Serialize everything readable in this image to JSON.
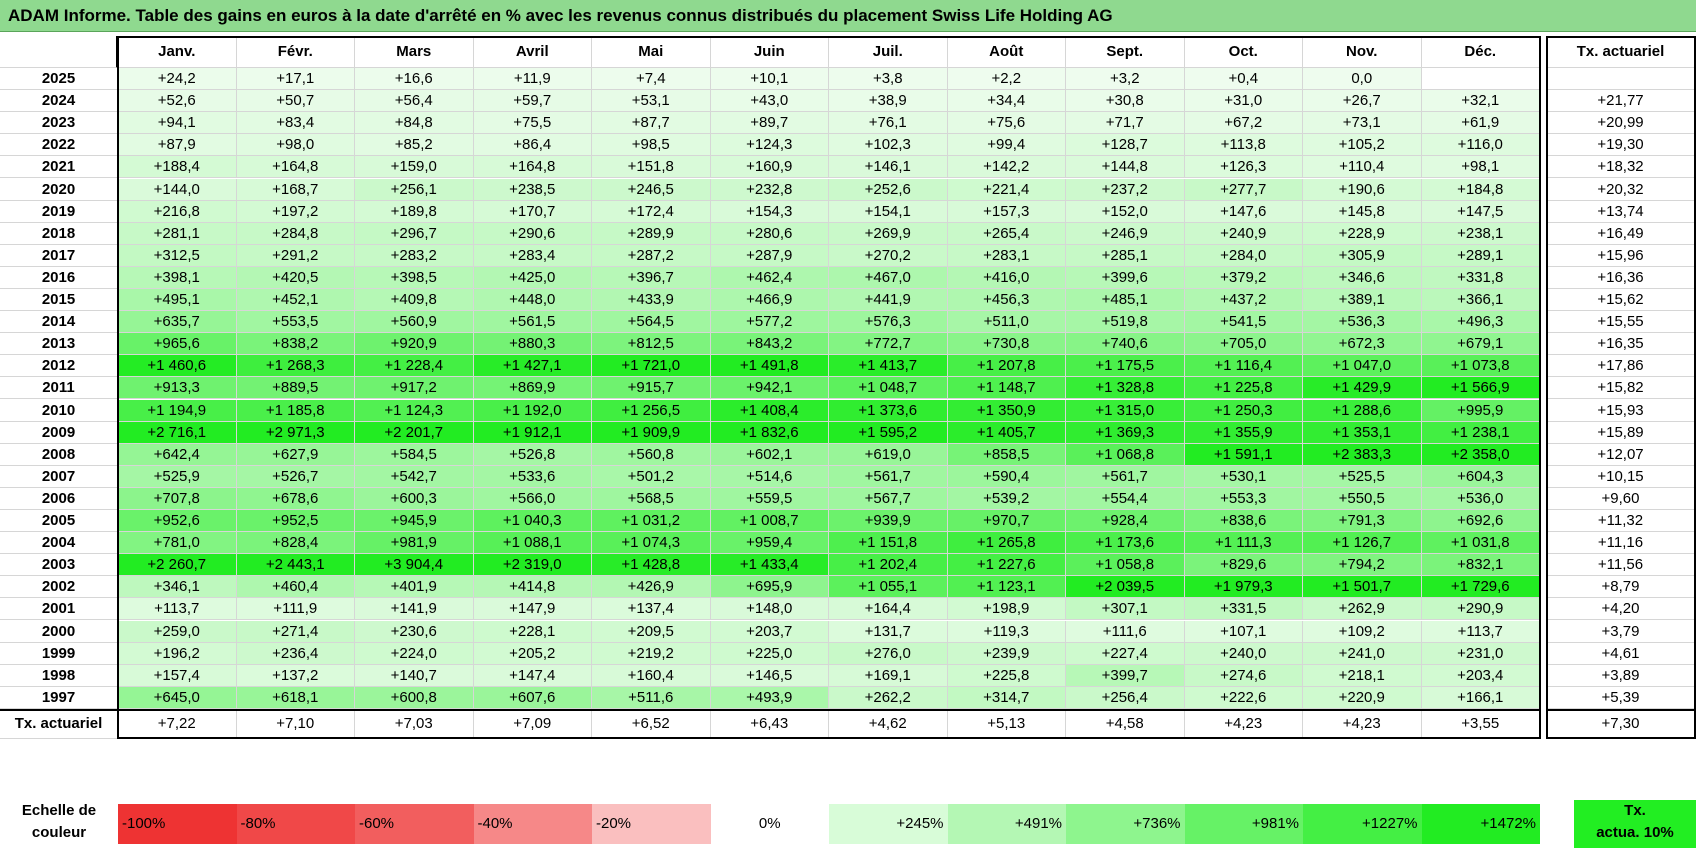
{
  "title": "ADAM Informe. Table des gains en euros à la date d'arrêté en % avec les revenus connus distribués du placement Swiss Life Holding AG",
  "months": [
    "Janv.",
    "Févr.",
    "Mars",
    "Avril",
    "Mai",
    "Juin",
    "Juil.",
    "Août",
    "Sept.",
    "Oct.",
    "Nov.",
    "Déc."
  ],
  "tx_header": "Tx. actuariel",
  "rows": [
    {
      "year": "2025",
      "values": [
        "+24,2",
        "+17,1",
        "+16,6",
        "+11,9",
        "+7,4",
        "+10,1",
        "+3,8",
        "+2,2",
        "+3,2",
        "+0,4",
        "0,0",
        ""
      ],
      "tx": ""
    },
    {
      "year": "2024",
      "values": [
        "+52,6",
        "+50,7",
        "+56,4",
        "+59,7",
        "+53,1",
        "+43,0",
        "+38,9",
        "+34,4",
        "+30,8",
        "+31,0",
        "+26,7",
        "+32,1"
      ],
      "tx": "+21,77"
    },
    {
      "year": "2023",
      "values": [
        "+94,1",
        "+83,4",
        "+84,8",
        "+75,5",
        "+87,7",
        "+89,7",
        "+76,1",
        "+75,6",
        "+71,7",
        "+67,2",
        "+73,1",
        "+61,9"
      ],
      "tx": "+20,99"
    },
    {
      "year": "2022",
      "values": [
        "+87,9",
        "+98,0",
        "+85,2",
        "+86,4",
        "+98,5",
        "+124,3",
        "+102,3",
        "+99,4",
        "+128,7",
        "+113,8",
        "+105,2",
        "+116,0"
      ],
      "tx": "+19,30"
    },
    {
      "year": "2021",
      "values": [
        "+188,4",
        "+164,8",
        "+159,0",
        "+164,8",
        "+151,8",
        "+160,9",
        "+146,1",
        "+142,2",
        "+144,8",
        "+126,3",
        "+110,4",
        "+98,1"
      ],
      "tx": "+18,32"
    },
    {
      "year": "2020",
      "values": [
        "+144,0",
        "+168,7",
        "+256,1",
        "+238,5",
        "+246,5",
        "+232,8",
        "+252,6",
        "+221,4",
        "+237,2",
        "+277,7",
        "+190,6",
        "+184,8"
      ],
      "tx": "+20,32"
    },
    {
      "year": "2019",
      "values": [
        "+216,8",
        "+197,2",
        "+189,8",
        "+170,7",
        "+172,4",
        "+154,3",
        "+154,1",
        "+157,3",
        "+152,0",
        "+147,6",
        "+145,8",
        "+147,5"
      ],
      "tx": "+13,74"
    },
    {
      "year": "2018",
      "values": [
        "+281,1",
        "+284,8",
        "+296,7",
        "+290,6",
        "+289,9",
        "+280,6",
        "+269,9",
        "+265,4",
        "+246,9",
        "+240,9",
        "+228,9",
        "+238,1"
      ],
      "tx": "+16,49"
    },
    {
      "year": "2017",
      "values": [
        "+312,5",
        "+291,2",
        "+283,2",
        "+283,4",
        "+287,2",
        "+287,9",
        "+270,2",
        "+283,1",
        "+285,1",
        "+284,0",
        "+305,9",
        "+289,1"
      ],
      "tx": "+15,96"
    },
    {
      "year": "2016",
      "values": [
        "+398,1",
        "+420,5",
        "+398,5",
        "+425,0",
        "+396,7",
        "+462,4",
        "+467,0",
        "+416,0",
        "+399,6",
        "+379,2",
        "+346,6",
        "+331,8"
      ],
      "tx": "+16,36"
    },
    {
      "year": "2015",
      "values": [
        "+495,1",
        "+452,1",
        "+409,8",
        "+448,0",
        "+433,9",
        "+466,9",
        "+441,9",
        "+456,3",
        "+485,1",
        "+437,2",
        "+389,1",
        "+366,1"
      ],
      "tx": "+15,62"
    },
    {
      "year": "2014",
      "values": [
        "+635,7",
        "+553,5",
        "+560,9",
        "+561,5",
        "+564,5",
        "+577,2",
        "+576,3",
        "+511,0",
        "+519,8",
        "+541,5",
        "+536,3",
        "+496,3"
      ],
      "tx": "+15,55"
    },
    {
      "year": "2013",
      "values": [
        "+965,6",
        "+838,2",
        "+920,9",
        "+880,3",
        "+812,5",
        "+843,2",
        "+772,7",
        "+730,8",
        "+740,6",
        "+705,0",
        "+672,3",
        "+679,1"
      ],
      "tx": "+16,35"
    },
    {
      "year": "2012",
      "values": [
        "+1 460,6",
        "+1 268,3",
        "+1 228,4",
        "+1 427,1",
        "+1 721,0",
        "+1 491,8",
        "+1 413,7",
        "+1 207,8",
        "+1 175,5",
        "+1 116,4",
        "+1 047,0",
        "+1 073,8"
      ],
      "tx": "+17,86"
    },
    {
      "year": "2011",
      "values": [
        "+913,3",
        "+889,5",
        "+917,2",
        "+869,9",
        "+915,7",
        "+942,1",
        "+1 048,7",
        "+1 148,7",
        "+1 328,8",
        "+1 225,8",
        "+1 429,9",
        "+1 566,9"
      ],
      "tx": "+15,82"
    },
    {
      "year": "2010",
      "values": [
        "+1 194,9",
        "+1 185,8",
        "+1 124,3",
        "+1 192,0",
        "+1 256,5",
        "+1 408,4",
        "+1 373,6",
        "+1 350,9",
        "+1 315,0",
        "+1 250,3",
        "+1 288,6",
        "+995,9"
      ],
      "tx": "+15,93"
    },
    {
      "year": "2009",
      "values": [
        "+2 716,1",
        "+2 971,3",
        "+2 201,7",
        "+1 912,1",
        "+1 909,9",
        "+1 832,6",
        "+1 595,2",
        "+1 405,7",
        "+1 369,3",
        "+1 355,9",
        "+1 353,1",
        "+1 238,1"
      ],
      "tx": "+15,89"
    },
    {
      "year": "2008",
      "values": [
        "+642,4",
        "+627,9",
        "+584,5",
        "+526,8",
        "+560,8",
        "+602,1",
        "+619,0",
        "+858,5",
        "+1 068,8",
        "+1 591,1",
        "+2 383,3",
        "+2 358,0"
      ],
      "tx": "+12,07"
    },
    {
      "year": "2007",
      "values": [
        "+525,9",
        "+526,7",
        "+542,7",
        "+533,6",
        "+501,2",
        "+514,6",
        "+561,7",
        "+590,4",
        "+561,7",
        "+530,1",
        "+525,5",
        "+604,3"
      ],
      "tx": "+10,15"
    },
    {
      "year": "2006",
      "values": [
        "+707,8",
        "+678,6",
        "+600,3",
        "+566,0",
        "+568,5",
        "+559,5",
        "+567,7",
        "+539,2",
        "+554,4",
        "+553,3",
        "+550,5",
        "+536,0"
      ],
      "tx": "+9,60"
    },
    {
      "year": "2005",
      "values": [
        "+952,6",
        "+952,5",
        "+945,9",
        "+1 040,3",
        "+1 031,2",
        "+1 008,7",
        "+939,9",
        "+970,7",
        "+928,4",
        "+838,6",
        "+791,3",
        "+692,6"
      ],
      "tx": "+11,32"
    },
    {
      "year": "2004",
      "values": [
        "+781,0",
        "+828,4",
        "+981,9",
        "+1 088,1",
        "+1 074,3",
        "+959,4",
        "+1 151,8",
        "+1 265,8",
        "+1 173,6",
        "+1 111,3",
        "+1 126,7",
        "+1 031,8"
      ],
      "tx": "+11,16"
    },
    {
      "year": "2003",
      "values": [
        "+2 260,7",
        "+2 443,1",
        "+3 904,4",
        "+2 319,0",
        "+1 428,8",
        "+1 433,4",
        "+1 202,4",
        "+1 227,6",
        "+1 058,8",
        "+829,6",
        "+794,2",
        "+832,1"
      ],
      "tx": "+11,56"
    },
    {
      "year": "2002",
      "values": [
        "+346,1",
        "+460,4",
        "+401,9",
        "+414,8",
        "+426,9",
        "+695,9",
        "+1 055,1",
        "+1 123,1",
        "+2 039,5",
        "+1 979,3",
        "+1 501,7",
        "+1 729,6"
      ],
      "tx": "+8,79"
    },
    {
      "year": "2001",
      "values": [
        "+113,7",
        "+111,9",
        "+141,9",
        "+147,9",
        "+137,4",
        "+148,0",
        "+164,4",
        "+198,9",
        "+307,1",
        "+331,5",
        "+262,9",
        "+290,9"
      ],
      "tx": "+4,20"
    },
    {
      "year": "2000",
      "values": [
        "+259,0",
        "+271,4",
        "+230,6",
        "+228,1",
        "+209,5",
        "+203,7",
        "+131,7",
        "+119,3",
        "+111,6",
        "+107,1",
        "+109,2",
        "+113,7"
      ],
      "tx": "+3,79"
    },
    {
      "year": "1999",
      "values": [
        "+196,2",
        "+236,4",
        "+224,0",
        "+205,2",
        "+219,2",
        "+225,0",
        "+276,0",
        "+239,9",
        "+227,4",
        "+240,0",
        "+241,0",
        "+231,0"
      ],
      "tx": "+4,61"
    },
    {
      "year": "1998",
      "values": [
        "+157,4",
        "+137,2",
        "+140,7",
        "+147,4",
        "+160,4",
        "+146,5",
        "+169,1",
        "+225,8",
        "+399,7",
        "+274,6",
        "+218,1",
        "+203,4"
      ],
      "tx": "+3,89"
    },
    {
      "year": "1997",
      "values": [
        "+645,0",
        "+618,1",
        "+600,8",
        "+607,6",
        "+511,6",
        "+493,9",
        "+262,2",
        "+314,7",
        "+256,4",
        "+222,6",
        "+220,9",
        "+166,1"
      ],
      "tx": "+5,39"
    }
  ],
  "footer": {
    "label": "Tx. actuariel",
    "values": [
      "+7,22",
      "+7,10",
      "+7,03",
      "+7,09",
      "+6,52",
      "+6,43",
      "+4,62",
      "+5,13",
      "+4,58",
      "+4,23",
      "+4,23",
      "+3,55"
    ],
    "total": "+7,30"
  },
  "scale": {
    "label_line1": "Echelle de",
    "label_line2": "couleur",
    "steps": [
      {
        "label": "-100%",
        "color": "#ee3333",
        "align": "left"
      },
      {
        "label": "-80%",
        "color": "#f04848",
        "align": "left"
      },
      {
        "label": "-60%",
        "color": "#f25e5e",
        "align": "left"
      },
      {
        "label": "-40%",
        "color": "#f68888",
        "align": "left"
      },
      {
        "label": "-20%",
        "color": "#fabfbf",
        "align": "left"
      },
      {
        "label": "0%",
        "color": "#ffffff",
        "align": "center"
      },
      {
        "label": "+245%",
        "color": "#d8fcd8",
        "align": "right"
      },
      {
        "label": "+491%",
        "color": "#b4f7b4",
        "align": "right"
      },
      {
        "label": "+736%",
        "color": "#8ef58e",
        "align": "right"
      },
      {
        "label": "+981%",
        "color": "#66f266",
        "align": "right"
      },
      {
        "label": "+1227%",
        "color": "#44ef44",
        "align": "right"
      },
      {
        "label": "+1472%",
        "color": "#22ec22",
        "align": "right"
      }
    ],
    "actua_line1": "Tx.",
    "actua_line2": "actua. 10%",
    "max_value": 1472
  }
}
